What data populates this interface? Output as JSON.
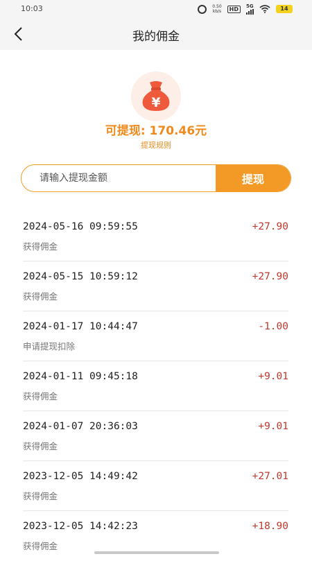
{
  "status_bar": {
    "time": "10:03",
    "net_speed": "0.50\nkb/s",
    "hd": "HD",
    "network": "5G",
    "battery": "14"
  },
  "header": {
    "title": "我的佣金"
  },
  "summary": {
    "balance_text": "可提现: 170.46元",
    "rules_link": "提现规则",
    "icon_symbol": "¥"
  },
  "withdraw": {
    "placeholder": "请输入提现金额",
    "button_label": "提现"
  },
  "records": [
    {
      "datetime": "2024-05-16 09:59:55",
      "desc": "获得佣金",
      "amount": "+27.90"
    },
    {
      "datetime": "2024-05-15 10:59:12",
      "desc": "获得佣金",
      "amount": "+27.90"
    },
    {
      "datetime": "2024-01-17 10:44:47",
      "desc": "申请提现扣除",
      "amount": "-1.00"
    },
    {
      "datetime": "2024-01-11 09:45:18",
      "desc": "获得佣金",
      "amount": "+9.01"
    },
    {
      "datetime": "2024-01-07 20:36:03",
      "desc": "获得佣金",
      "amount": "+9.01"
    },
    {
      "datetime": "2023-12-05 14:49:42",
      "desc": "获得佣金",
      "amount": "+27.01"
    },
    {
      "datetime": "2023-12-05 14:42:23",
      "desc": "获得佣金",
      "amount": "+18.90"
    }
  ],
  "colors": {
    "accent": "#f29a25",
    "balance_text": "#f08a1c",
    "amount": "#c0392b",
    "bag": "#ef5a3c"
  }
}
